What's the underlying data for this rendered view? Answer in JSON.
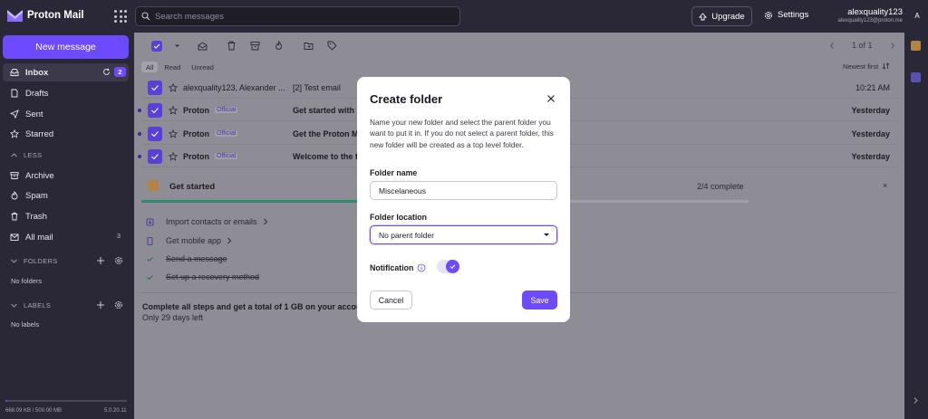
{
  "app": {
    "brand": "Proton Mail"
  },
  "colors": {
    "accent": "#6d4aff",
    "sidebar": "#2a2836",
    "success": "#2e8c6a"
  },
  "search": {
    "placeholder": "Search messages"
  },
  "header": {
    "upgrade_label": "Upgrade",
    "settings_label": "Settings",
    "account_name": "alexquality123",
    "account_email": "alexquality123@proton.me",
    "avatar_initial": "A"
  },
  "sidebar": {
    "new_message_label": "New message",
    "items": [
      {
        "label": "Inbox",
        "icon": "inbox-icon",
        "badge": "2"
      },
      {
        "label": "Drafts",
        "icon": "file-icon"
      },
      {
        "label": "Sent",
        "icon": "paper-plane-icon"
      },
      {
        "label": "Starred",
        "icon": "star-icon"
      },
      {
        "label": "LESS",
        "icon": "chevron-up-icon"
      },
      {
        "label": "Archive",
        "icon": "archive-icon"
      },
      {
        "label": "Spam",
        "icon": "fire-icon"
      },
      {
        "label": "Trash",
        "icon": "trash-icon"
      },
      {
        "label": "All mail",
        "icon": "envelopes-icon",
        "count": "3"
      }
    ],
    "folders_label": "FOLDERS",
    "no_folders": "No folders",
    "labels_label": "LABELS",
    "no_labels": "No labels",
    "storage": "668.09 KB / 500.00 MB",
    "storage_fraction": 0.0013,
    "version": "5.0.20.11"
  },
  "list": {
    "pager": "1 of 1",
    "filters": [
      "All",
      "Read",
      "Unread"
    ],
    "sort_label": "Newest first",
    "rows": [
      {
        "from": "alexquality123, Alexander ...",
        "tag": "",
        "subject": "[2] Test email",
        "time": "10:21 AM",
        "unread": false
      },
      {
        "from": "Proton",
        "tag": "Official",
        "subject": "Get started with P",
        "time": "Yesterday",
        "unread": true
      },
      {
        "from": "Proton",
        "tag": "Official",
        "subject": "Get the Proton Ma",
        "time": "Yesterday",
        "unread": true
      },
      {
        "from": "Proton",
        "tag": "Official",
        "subject": "Welcome to the fu",
        "time": "Yesterday",
        "unread": true
      }
    ]
  },
  "get_started": {
    "title": "Get started",
    "progress_text": "2/4 complete",
    "progress_fraction": 0.5,
    "close": "×",
    "tasks": [
      {
        "label": "Import contacts or emails",
        "done": false,
        "icon": "import-icon"
      },
      {
        "label": "Get mobile app",
        "done": false,
        "icon": "mobile-icon"
      },
      {
        "label": "Send a message",
        "done": true,
        "icon": "check-icon"
      },
      {
        "label": "Set up a recovery method",
        "done": true,
        "icon": "check-icon"
      }
    ],
    "promo": "Complete all steps and get a total of 1 GB on your account",
    "days_left": "Only 29 days left"
  },
  "modal": {
    "title": "Create folder",
    "description": "Name your new folder and select the parent folder you want to put it in. If you do not select a parent folder, this new folder will be created as a top level folder.",
    "name_label": "Folder name",
    "name_value": "Miscelaneous",
    "location_label": "Folder location",
    "location_value": "No parent folder",
    "notification_label": "Notification",
    "notification_on": true,
    "cancel_label": "Cancel",
    "save_label": "Save"
  }
}
